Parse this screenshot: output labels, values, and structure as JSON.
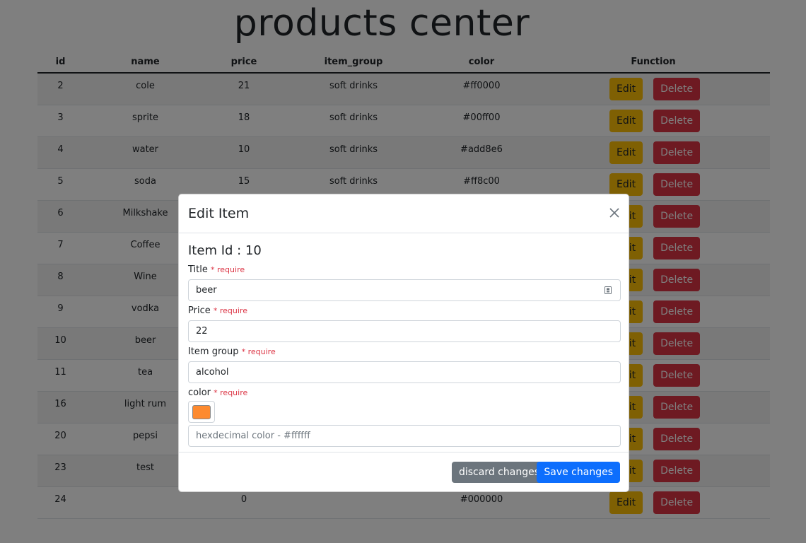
{
  "page": {
    "title": "products center"
  },
  "table": {
    "headers": [
      "id",
      "name",
      "price",
      "item_group",
      "color",
      "Function"
    ],
    "edit_label": "Edit",
    "delete_label": "Delete",
    "rows": [
      {
        "id": "2",
        "name": "cole",
        "price": "21",
        "item_group": "soft drinks",
        "color": "#ff0000"
      },
      {
        "id": "3",
        "name": "sprite",
        "price": "18",
        "item_group": "soft drinks",
        "color": "#00ff00"
      },
      {
        "id": "4",
        "name": "water",
        "price": "10",
        "item_group": "soft drinks",
        "color": "#add8e6"
      },
      {
        "id": "5",
        "name": "soda",
        "price": "15",
        "item_group": "soft drinks",
        "color": "#ff8c00"
      },
      {
        "id": "6",
        "name": "Milkshake",
        "price": "",
        "item_group": "",
        "color": ""
      },
      {
        "id": "7",
        "name": "Coffee",
        "price": "",
        "item_group": "",
        "color": ""
      },
      {
        "id": "8",
        "name": "Wine",
        "price": "",
        "item_group": "",
        "color": ""
      },
      {
        "id": "9",
        "name": "vodka",
        "price": "",
        "item_group": "",
        "color": ""
      },
      {
        "id": "10",
        "name": "beer",
        "price": "",
        "item_group": "",
        "color": ""
      },
      {
        "id": "11",
        "name": "tea",
        "price": "",
        "item_group": "",
        "color": ""
      },
      {
        "id": "16",
        "name": "light rum",
        "price": "",
        "item_group": "",
        "color": ""
      },
      {
        "id": "20",
        "name": "pepsi",
        "price": "",
        "item_group": "",
        "color": ""
      },
      {
        "id": "23",
        "name": "test",
        "price": "",
        "item_group": "",
        "color": ""
      },
      {
        "id": "24",
        "name": "",
        "price": "0",
        "item_group": "",
        "color": "#000000"
      }
    ]
  },
  "modal": {
    "title": "Edit Item",
    "item_id_label": "Item Id : 10",
    "require_text": "* require",
    "title_label": "Title",
    "title_value": "beer",
    "price_label": "Price",
    "price_value": "22",
    "group_label": "Item group",
    "group_value": "alcohol",
    "color_label": "color",
    "color_swatch": "#fd8a2f",
    "color_placeholder": "hexdecimal color - #ffffff",
    "discard_label": "discard changes",
    "save_label": "Save changes"
  },
  "colors": {
    "edit": "#ffc107",
    "delete": "#dc3545",
    "save": "#0d6efd",
    "discard": "#6c757d"
  }
}
